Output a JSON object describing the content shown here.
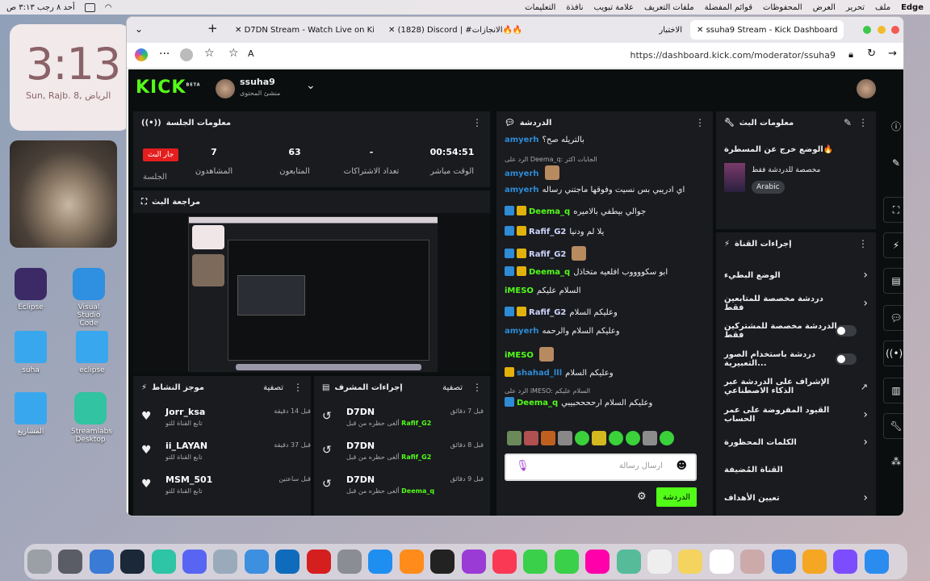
{
  "menubar": {
    "app": "Edge",
    "items": [
      "ملف",
      "تحرير",
      "العرض",
      "المحفوظات",
      "قوائم المفضلة",
      "ملفات التعريف",
      "علامة تبويب",
      "نافذة",
      "التعليمات"
    ],
    "datetime": "أحد ٨ رجب ٣:١٣ ص"
  },
  "widget": {
    "time": "3:13",
    "date": "Sun, Rajb. 8,  الرياض"
  },
  "desktop_icons": [
    {
      "label": "Eclipse",
      "color": "#3b2a66"
    },
    {
      "label": "Visual Studio Code",
      "color": "#2f8fe0"
    },
    {
      "label": "suha",
      "color": "#39a7ee"
    },
    {
      "label": "eclipse",
      "color": "#39a7ee"
    },
    {
      "label": "المشاريع",
      "color": "#39a7ee"
    },
    {
      "label": "Streamlabs Desktop",
      "color": "#31c3a2"
    }
  ],
  "tabs": [
    {
      "label": "D7DN Stream - Watch Live on Kick",
      "active": false
    },
    {
      "label": "(1828) Discord | #الانجازات🔥🔥",
      "active": false
    },
    {
      "label": "الاختبار",
      "active": false
    },
    {
      "label": "ssuha9 Stream - Kick Dashboard",
      "active": true
    }
  ],
  "url": "https://dashboard.kick.com/moderator/ssuha9",
  "kick": {
    "logo": "KICK",
    "beta": "BETA",
    "channel": "ssuha9",
    "role": "منشئ المحتوى"
  },
  "session": {
    "title": "معلومات الجلسة",
    "live_badge": "جار البث",
    "session_label": "الجلسة",
    "stats": [
      {
        "value": "7",
        "label": "المشاهدون"
      },
      {
        "value": "63",
        "label": "المتابعون"
      },
      {
        "value": "-",
        "label": "تعداد الاشتراكات"
      },
      {
        "value": "00:54:51",
        "label": "الوقت مباشر"
      }
    ]
  },
  "preview": {
    "title": "مراجعة البث"
  },
  "activity": {
    "title": "موجز النشاط",
    "filter": "تصفية",
    "items": [
      {
        "name": "Jorr_ksa",
        "sub": "تابع القناة للتو",
        "time": "قبل 14 دقيقة"
      },
      {
        "name": "ii_LAYAN",
        "sub": "تابع القناة للتو",
        "time": "قبل 37 دقيقة"
      },
      {
        "name": "MSM_501",
        "sub": "تابع القناة للتو",
        "time": "قبل ساعتين"
      }
    ]
  },
  "modactions": {
    "title": "إجراءات المشرف",
    "filter": "تصفية",
    "items": [
      {
        "name": "D7DN",
        "sub": "ألغى حظره من قبل",
        "by": "Rafif_G2",
        "time": "قبل 7 دقائق"
      },
      {
        "name": "D7DN",
        "sub": "ألغى حظره من قبل",
        "by": "Rafif_G2",
        "time": "قبل 8 دقائق"
      },
      {
        "name": "D7DN",
        "sub": "ألغى حظره من قبل",
        "by": "Deema_q",
        "time": "قبل 9 دقائق"
      }
    ]
  },
  "chat": {
    "title": "الدردشة",
    "input_placeholder": "ارسال رسالة",
    "send": "الدردشة",
    "messages": [
      {
        "user": "amyerh",
        "color": "#2e8bd6",
        "text": "بالتريله صح؟",
        "badges": [],
        "reply": ""
      },
      {
        "user": "amyerh",
        "color": "#2e8bd6",
        "text": "",
        "badges": [],
        "reply": "الرد على Deema_q: الجابات اكثر"
      },
      {
        "user": "amyerh",
        "color": "#2e8bd6",
        "text": "اي ادريبي بس نسيت وفوقها ماجتني رساله",
        "badges": [],
        "reply": ""
      },
      {
        "user": "Deema_q",
        "color": "#53fc18",
        "text": "جوالي بيطفي بالاميره",
        "badges": [
          "mod",
          "sub"
        ],
        "reply": ""
      },
      {
        "user": "Rafif_G2",
        "color": "#cfd6ff",
        "text": "يلا لم ودنيا",
        "badges": [
          "mod",
          "sub"
        ],
        "reply": ""
      },
      {
        "user": "Rafif_G2",
        "color": "#cfd6ff",
        "text": "",
        "badges": [
          "mod",
          "sub"
        ],
        "reply": ""
      },
      {
        "user": "Deema_q",
        "color": "#53fc18",
        "text": "ابو سكووووب افلعيه متخاذل",
        "badges": [
          "mod",
          "sub"
        ],
        "reply": ""
      },
      {
        "user": "iMESO",
        "color": "#53fc18",
        "text": "السلام عليكم",
        "badges": [],
        "reply": ""
      },
      {
        "user": "Rafif_G2",
        "color": "#cfd6ff",
        "text": "وعليكم السلام",
        "badges": [
          "mod",
          "sub"
        ],
        "reply": ""
      },
      {
        "user": "amyerh",
        "color": "#2e8bd6",
        "text": "وعليكم السلام والرحمه",
        "badges": [],
        "reply": ""
      },
      {
        "user": "iMESO",
        "color": "#53fc18",
        "text": "",
        "badges": [],
        "reply": ""
      },
      {
        "user": "shahad_lll",
        "color": "#2e8bd6",
        "text": "وعليكم السلام",
        "badges": [
          "sub"
        ],
        "reply": ""
      },
      {
        "user": "Deema_q",
        "color": "#53fc18",
        "text": "وعليكم السلام ارححححبيبي",
        "badges": [
          "mod"
        ],
        "reply": "الرد على iMESO: السلام عليكم"
      }
    ]
  },
  "streaminfo": {
    "title": "معلومات البث",
    "headline": "الوضع خرج عن المسطرة🔥",
    "sub": "مخصصة للدردشة فقط",
    "tag": "Arabic"
  },
  "channel_actions": {
    "title": "إجراءات القناة",
    "items": [
      {
        "label": "الوضع البطيء",
        "type": "arrow"
      },
      {
        "label": "دردشة مخصصة للمتابعين فقط",
        "type": "arrow"
      },
      {
        "label": "الدردشة مخصصة للمشتركين فقط",
        "type": "toggle"
      },
      {
        "label": "دردشة باستخدام الصور التعبيرية...",
        "type": "toggle"
      },
      {
        "label": "الإشراف على الدردشة عبر الذكاء الاصطناعي",
        "type": "link"
      },
      {
        "label": "القيود المفروضة على عمر الحساب",
        "type": "arrow"
      },
      {
        "label": "الكلمات المحظورة",
        "type": "arrow"
      },
      {
        "label": "القناة المُضيفة",
        "type": "none"
      },
      {
        "label": "تعيين الأهداف",
        "type": "arrow"
      }
    ]
  },
  "colors": {
    "kick_green": "#53fc18",
    "panel": "#191b1f",
    "bg": "#0b0e0f",
    "live_red": "#e41e1e"
  },
  "dock": [
    "finder",
    "launchpad",
    "safari",
    "steam",
    "streamlabs",
    "discord",
    "preview",
    "safari-2",
    "edge",
    "opera",
    "settings",
    "appstore",
    "books",
    "tv",
    "podcasts",
    "music",
    "facetime",
    "messages",
    "photos",
    "maps",
    "reminders",
    "notes",
    "calendar",
    "keychain",
    "mail",
    "grid",
    "siri",
    "finder-2"
  ]
}
